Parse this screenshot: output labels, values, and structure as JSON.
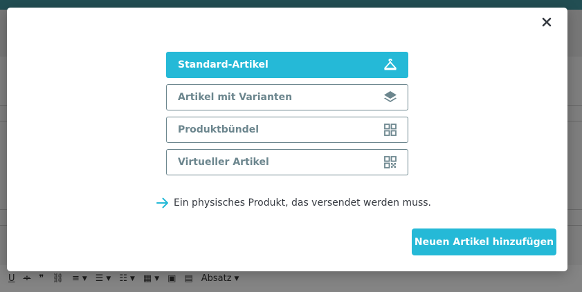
{
  "modal": {
    "options": [
      {
        "label": "Standard-Artikel",
        "icon": "hanger-icon",
        "selected": true
      },
      {
        "label": "Artikel mit Varianten",
        "icon": "layers-icon",
        "selected": false
      },
      {
        "label": "Produktbündel",
        "icon": "grid-icon",
        "selected": false
      },
      {
        "label": "Virtueller Artikel",
        "icon": "qr-code-icon",
        "selected": false
      }
    ],
    "hint_text": "Ein physisches Produkt, das versendet werden muss.",
    "add_button_label": "Neuen Artikel hinzufügen",
    "colors": {
      "accent": "#25b9d7",
      "option_border": "#6c868e",
      "text": "#363a41"
    }
  },
  "background_toolbar": {
    "format_label": "Absatz"
  }
}
